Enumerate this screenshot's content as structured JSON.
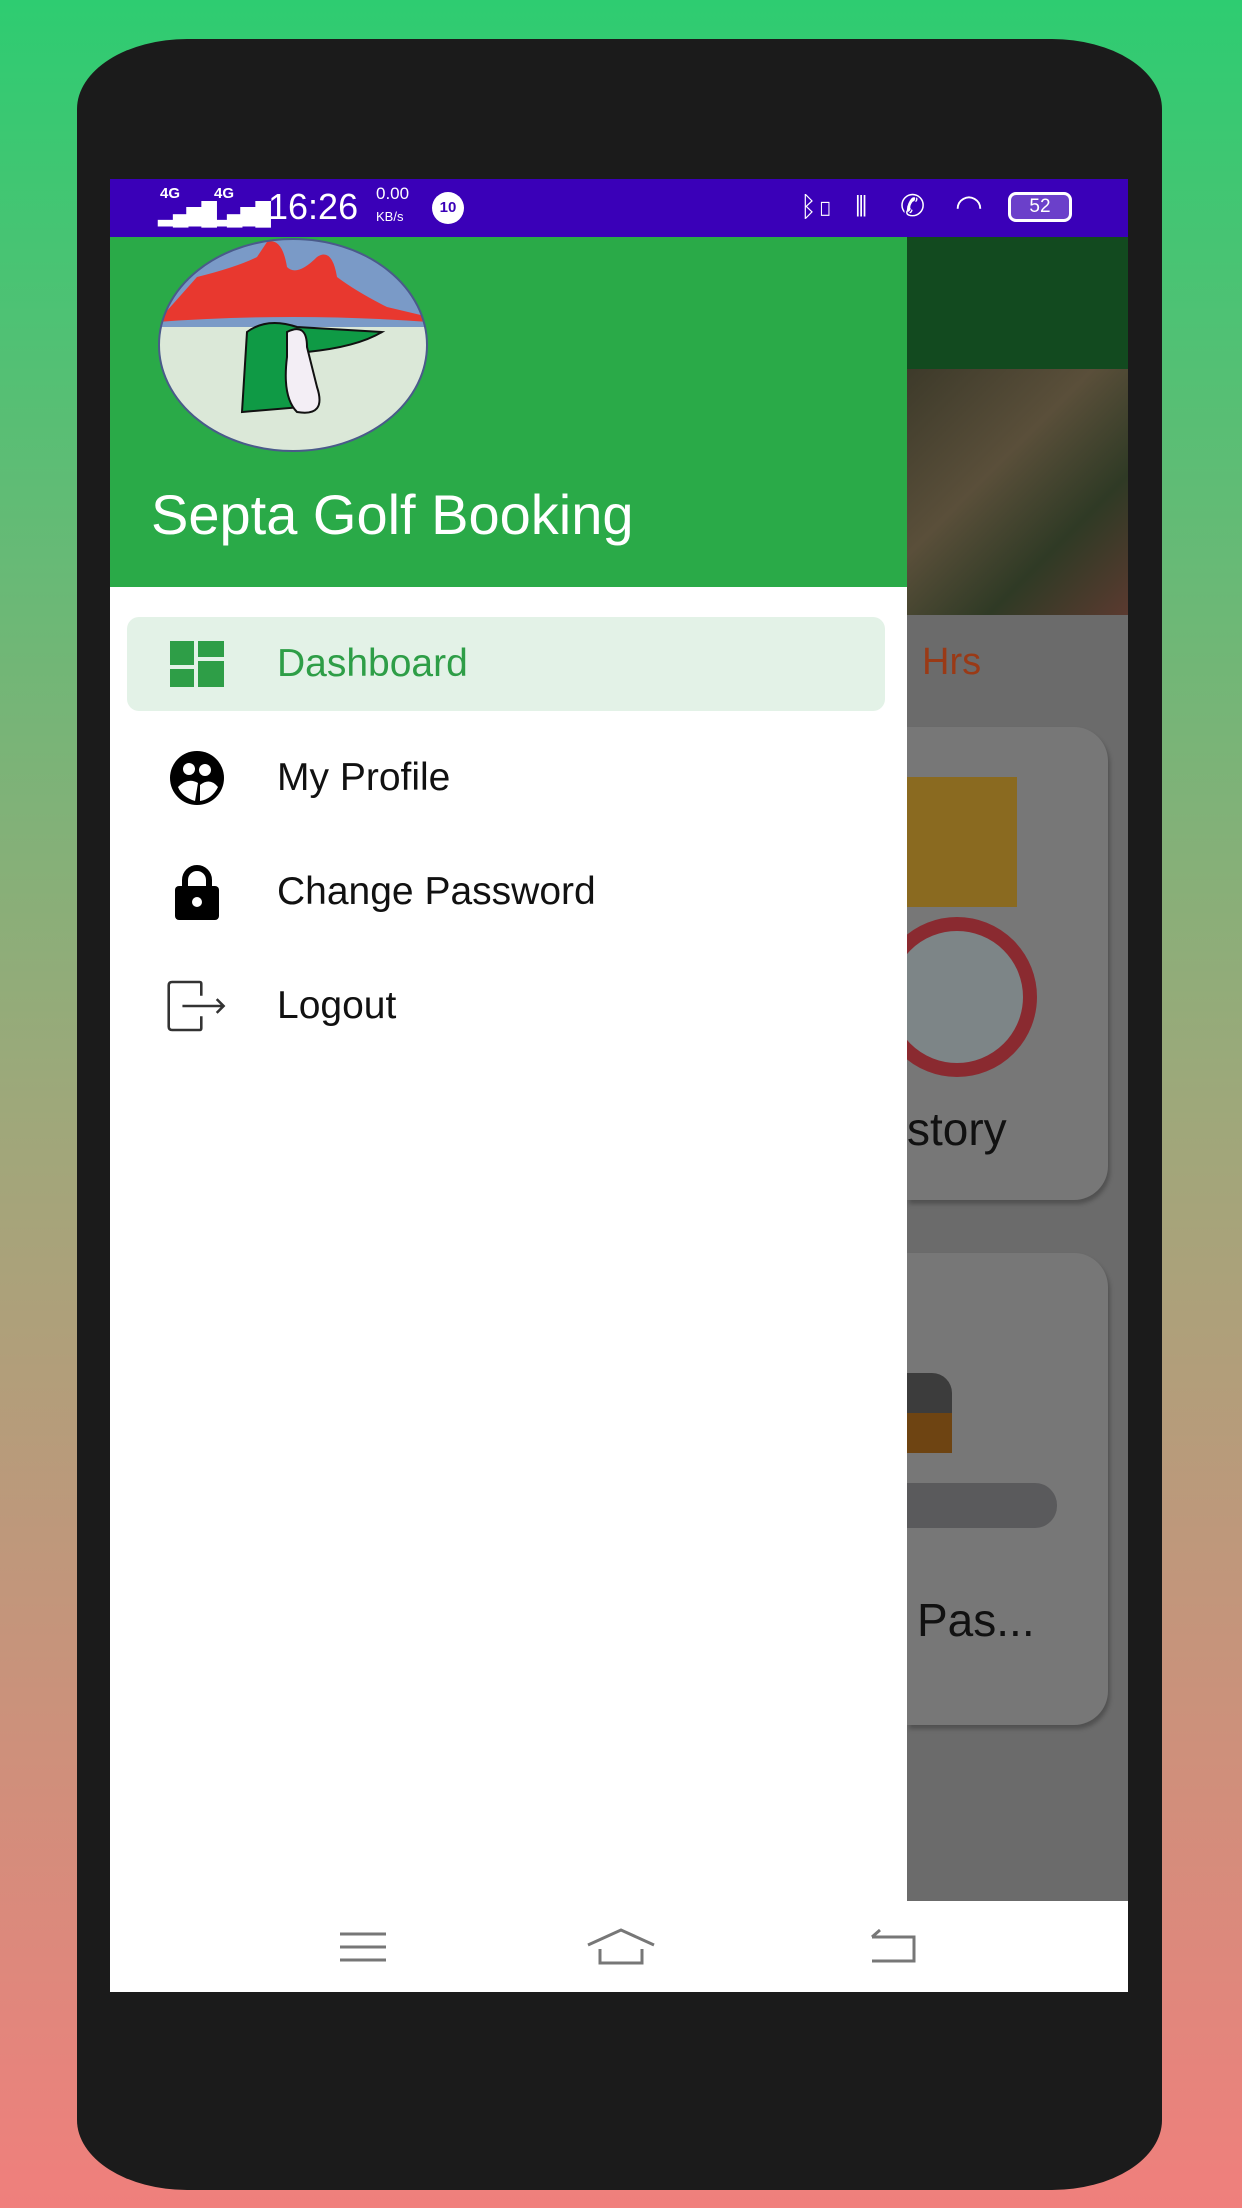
{
  "status_bar": {
    "network1": "4G",
    "network2": "4G",
    "time": "16:26",
    "speed_value": "0.00",
    "speed_unit": "KB/s",
    "notification_badge": "10",
    "battery": "52",
    "color": "#3a00b8"
  },
  "drawer": {
    "title": "Septa Golf Booking",
    "header_color": "#2aaa48",
    "items": [
      {
        "label": "Dashboard",
        "icon": "dashboard-icon",
        "active": true
      },
      {
        "label": "My Profile",
        "icon": "profile-icon"
      },
      {
        "label": "Change Password",
        "icon": "lock-icon"
      },
      {
        "label": "Logout",
        "icon": "logout-icon"
      }
    ]
  },
  "background_app": {
    "hours_label": "Hrs",
    "card1_label": "story",
    "card2_label": "Pas..."
  },
  "nav_bar": {
    "buttons": [
      "menu-icon",
      "home-icon",
      "back-icon"
    ]
  }
}
